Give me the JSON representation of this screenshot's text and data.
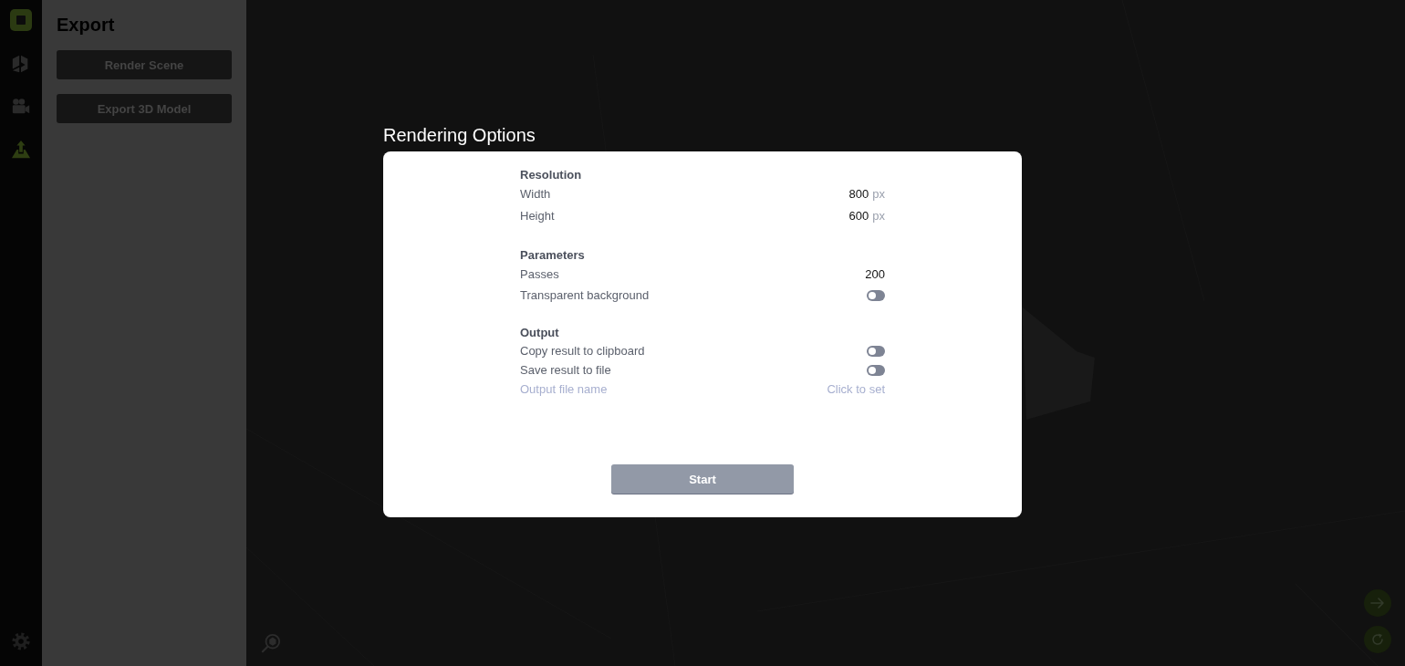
{
  "rail": {
    "items": [
      {
        "selected": false
      },
      {
        "selected": false
      },
      {
        "selected": true
      }
    ]
  },
  "panel": {
    "title": "Export",
    "buttons": [
      "Render Scene",
      "Export 3D Model"
    ]
  },
  "dialog": {
    "title": "Rendering Options",
    "sections": [
      {
        "heading": "Resolution",
        "rows": [
          {
            "kind": "number",
            "label": "Width",
            "value": "800",
            "unit": "px"
          },
          {
            "kind": "number",
            "label": "Height",
            "value": "600",
            "unit": "px"
          }
        ]
      },
      {
        "heading": "Parameters",
        "rows": [
          {
            "kind": "number",
            "label": "Passes",
            "value": "200"
          },
          {
            "kind": "toggle",
            "label": "Transparent background",
            "on": false
          }
        ]
      },
      {
        "heading": "Output",
        "rows": [
          {
            "kind": "toggle",
            "label": "Copy result to clipboard",
            "on": false
          },
          {
            "kind": "toggle",
            "label": "Save result to file",
            "on": false
          },
          {
            "kind": "link",
            "label": "Output file name",
            "value": "Click to set",
            "disabled": true
          }
        ]
      }
    ],
    "start_button": {
      "label": "Start",
      "disabled": true
    }
  }
}
